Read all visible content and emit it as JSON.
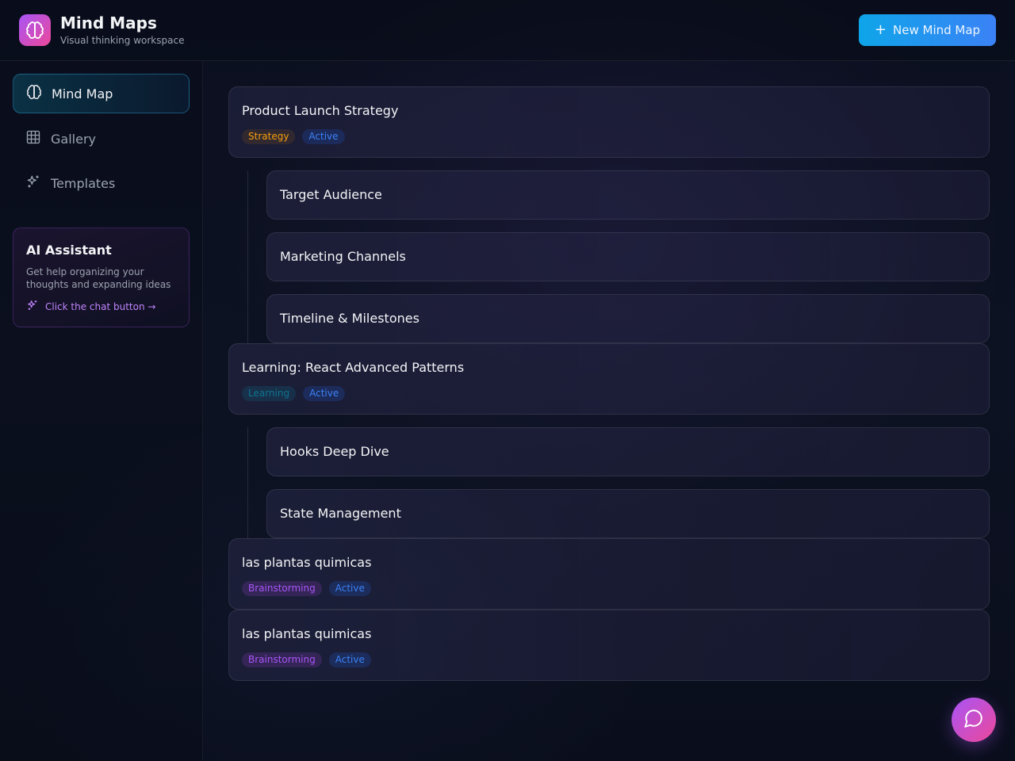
{
  "header": {
    "title": "Mind Maps",
    "subtitle": "Visual thinking workspace",
    "new_button_label": "New Mind Map",
    "new_button_icon": "plus-icon"
  },
  "sidebar": {
    "items": [
      {
        "label": "Mind Map",
        "icon": "brain-icon",
        "active": true
      },
      {
        "label": "Gallery",
        "icon": "grid-icon",
        "active": false
      },
      {
        "label": "Templates",
        "icon": "sparkles-icon",
        "active": false
      }
    ],
    "assistant": {
      "title": "AI Assistant",
      "description": "Get help organizing your thoughts and expanding ideas",
      "link": "Click the chat button →"
    }
  },
  "maps": [
    {
      "title": "Product Launch Strategy",
      "tags": [
        "Strategy",
        "Active"
      ],
      "children": [
        "Target Audience",
        "Marketing Channels",
        "Timeline & Milestones"
      ]
    },
    {
      "title": "Learning: React Advanced Patterns",
      "tags": [
        "Learning",
        "Active"
      ],
      "children": [
        "Hooks Deep Dive",
        "State Management"
      ]
    },
    {
      "title": "las plantas quimicas",
      "tags": [
        "Brainstorming",
        "Active"
      ],
      "children": []
    },
    {
      "title": "las plantas quimicas",
      "tags": [
        "Brainstorming",
        "Active"
      ],
      "children": []
    }
  ],
  "colors": {
    "accent_cyan": "#0ea5e9",
    "accent_purple": "#a855f7",
    "accent_pink": "#ec4899",
    "tag_strategy": "#f59e0b",
    "tag_active": "#3b82f6",
    "tag_learning": "#0e7490",
    "tag_brainstorming": "#a855f7"
  },
  "chat_button_icon": "chat-bubble-icon"
}
